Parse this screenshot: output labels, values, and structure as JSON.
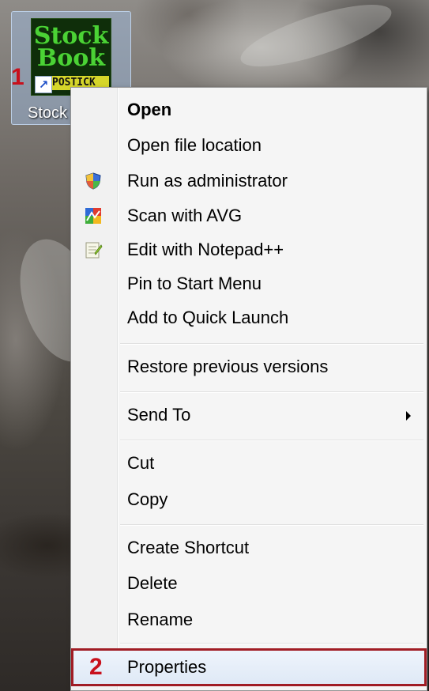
{
  "desktop": {
    "icon": {
      "image_line1": "Stock",
      "image_line2": "Book",
      "image_ticker": "POSTICK",
      "label": "Stock"
    },
    "step_markers": {
      "first": "1",
      "second": "2"
    }
  },
  "context_menu": {
    "items": [
      {
        "label": "Open",
        "bold": true,
        "icon": null
      },
      {
        "label": "Open file location",
        "icon": null
      },
      {
        "label": "Run as administrator",
        "icon": "uac-shield-icon"
      },
      {
        "label": "Scan with AVG",
        "icon": "avg-icon"
      },
      {
        "label": "Edit with Notepad++",
        "icon": "notepad-plus-plus-icon"
      },
      {
        "label": "Pin to Start Menu",
        "icon": null
      },
      {
        "label": "Add to Quick Launch",
        "icon": null
      },
      {
        "label": "Restore previous versions",
        "icon": null
      },
      {
        "label": "Send To",
        "icon": null,
        "submenu": true
      },
      {
        "label": "Cut",
        "icon": null
      },
      {
        "label": "Copy",
        "icon": null
      },
      {
        "label": "Create Shortcut",
        "icon": null
      },
      {
        "label": "Delete",
        "icon": null
      },
      {
        "label": "Rename",
        "icon": null
      },
      {
        "label": "Properties",
        "icon": null,
        "highlighted": true
      }
    ]
  },
  "colors": {
    "marker_red": "#c8101c",
    "highlight_border": "#a01c24",
    "menu_background": "#f5f5f5"
  }
}
